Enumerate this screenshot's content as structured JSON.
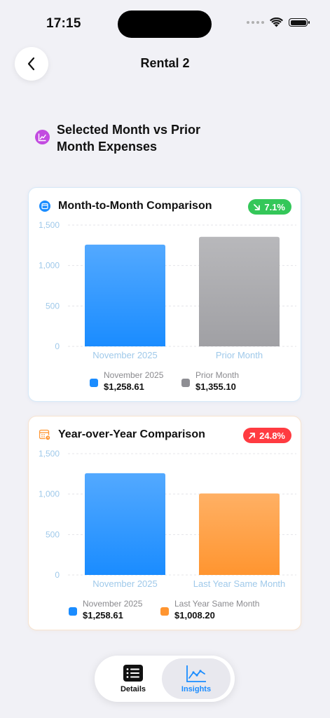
{
  "status_bar": {
    "time": "17:15"
  },
  "nav": {
    "title": "Rental 2",
    "back_icon": "chevron-left-icon"
  },
  "section": {
    "title": "Selected Month vs Prior Month Expenses",
    "icon": "trend-chart-icon",
    "icon_color": "#c24be0"
  },
  "cards": {
    "mom": {
      "title": "Month-to-Month Comparison",
      "icon": "calendar-icon",
      "badge": {
        "text": "7.1%",
        "direction": "down",
        "color": "#34c759"
      },
      "chart_data": {
        "type": "bar",
        "categories": [
          "November 2025",
          "Prior Month"
        ],
        "values": [
          1258.61,
          1355.1
        ],
        "colors": [
          "#1a8cff",
          "#a0a0a4"
        ],
        "yticks": [
          "0",
          "500",
          "1,000",
          "1,500"
        ],
        "ylim": [
          0,
          1500
        ],
        "grid": true
      },
      "legend": [
        {
          "name": "November 2025",
          "value": "$1,258.61",
          "color": "#1a8cff"
        },
        {
          "name": "Prior Month",
          "value": "$1,355.10",
          "color": "#8e8e93"
        }
      ]
    },
    "yoy": {
      "title": "Year-over-Year Comparison",
      "icon": "calendar-clock-icon",
      "badge": {
        "text": "24.8%",
        "direction": "up",
        "color": "#ff3b41"
      },
      "chart_data": {
        "type": "bar",
        "categories": [
          "November 2025",
          "Last Year Same Month"
        ],
        "values": [
          1258.61,
          1008.2
        ],
        "colors": [
          "#1a8cff",
          "#ff9530"
        ],
        "yticks": [
          "0",
          "500",
          "1,000",
          "1,500"
        ],
        "ylim": [
          0,
          1500
        ],
        "grid": true
      },
      "legend": [
        {
          "name": "November 2025",
          "value": "$1,258.61",
          "color": "#1a8cff"
        },
        {
          "name": "Last Year Same Month",
          "value": "$1,008.20",
          "color": "#ff9530"
        }
      ]
    }
  },
  "tabbar": {
    "tabs": [
      {
        "label": "Details",
        "icon": "list-icon",
        "selected": false
      },
      {
        "label": "Insights",
        "icon": "line-chart-icon",
        "selected": true
      }
    ]
  }
}
